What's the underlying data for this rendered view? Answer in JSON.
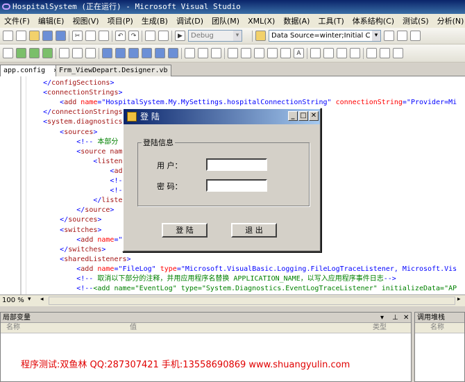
{
  "window": {
    "title": "HospitalSystem (正在运行) - Microsoft Visual Studio"
  },
  "menu": [
    "文件(F)",
    "编辑(E)",
    "视图(V)",
    "项目(P)",
    "生成(B)",
    "调试(D)",
    "团队(M)",
    "XML(X)",
    "数据(A)",
    "工具(T)",
    "体系结构(C)",
    "测试(S)",
    "分析(N)",
    "窗"
  ],
  "toolbar": {
    "config": "Debug",
    "datasource": "Data Source=winter;Initial C"
  },
  "tabs": [
    "app.config",
    "Frm_ViewDepart.Designer.vb"
  ],
  "editor": {
    "lines": [
      {
        "indent": "    ",
        "parts": [
          [
            "br",
            "</"
          ],
          [
            "tag",
            "configSections"
          ],
          [
            "br",
            ">"
          ]
        ]
      },
      {
        "indent": "    ",
        "parts": [
          [
            "br",
            "<"
          ],
          [
            "tag",
            "connectionStrings"
          ],
          [
            "br",
            ">"
          ]
        ]
      },
      {
        "indent": "        ",
        "parts": [
          [
            "br",
            "<"
          ],
          [
            "tag",
            "add "
          ],
          [
            "at",
            "name"
          ],
          [
            "br",
            "=\""
          ],
          [
            "av",
            "HospitalSystem.My.MySettings.hospitalConnectionString"
          ],
          [
            "br",
            "\" "
          ],
          [
            "at",
            "connectionString"
          ],
          [
            "br",
            "=\""
          ],
          [
            "av",
            "Provider=Mi"
          ]
        ]
      },
      {
        "indent": "    ",
        "parts": [
          [
            "br",
            "</"
          ],
          [
            "tag",
            "connectionStrings"
          ],
          [
            "br",
            ">"
          ]
        ]
      },
      {
        "indent": "    ",
        "parts": [
          [
            "br",
            "<"
          ],
          [
            "tag",
            "system.diagnostics"
          ],
          [
            "br",
            ">"
          ]
        ]
      },
      {
        "indent": "        ",
        "parts": [
          [
            "br",
            "<"
          ],
          [
            "tag",
            "sources"
          ],
          [
            "br",
            ">"
          ]
        ]
      },
      {
        "indent": "            ",
        "parts": [
          [
            "br",
            "<!--"
          ],
          [
            "cm",
            " 本部分"
          ]
        ]
      },
      {
        "indent": "            ",
        "parts": [
          [
            "br",
            "<"
          ],
          [
            "tag",
            "source nam"
          ]
        ]
      },
      {
        "indent": "                ",
        "parts": [
          [
            "br",
            "<"
          ],
          [
            "tag",
            "listen"
          ]
        ]
      },
      {
        "indent": "                    ",
        "parts": [
          [
            "br",
            "<"
          ],
          [
            "tag",
            "ad"
          ]
        ]
      },
      {
        "indent": "                    ",
        "parts": [
          [
            "br",
            "<!-"
          ]
        ]
      },
      {
        "indent": "                    ",
        "parts": [
          [
            "br",
            "<!-"
          ]
        ]
      },
      {
        "indent": "                ",
        "parts": [
          [
            "br",
            "</"
          ],
          [
            "tag",
            "liste"
          ]
        ]
      },
      {
        "indent": "            ",
        "parts": [
          [
            "br",
            "</"
          ],
          [
            "tag",
            "source"
          ],
          [
            "br",
            ">"
          ]
        ]
      },
      {
        "indent": "        ",
        "parts": [
          [
            "br",
            "</"
          ],
          [
            "tag",
            "sources"
          ],
          [
            "br",
            ">"
          ]
        ]
      },
      {
        "indent": "        ",
        "parts": [
          [
            "br",
            "<"
          ],
          [
            "tag",
            "switches"
          ],
          [
            "br",
            ">"
          ]
        ]
      },
      {
        "indent": "            ",
        "parts": [
          [
            "br",
            "<"
          ],
          [
            "tag",
            "add "
          ],
          [
            "at",
            "name"
          ],
          [
            "br",
            "=\""
          ]
        ]
      },
      {
        "indent": "        ",
        "parts": [
          [
            "br",
            "</"
          ],
          [
            "tag",
            "switches"
          ],
          [
            "br",
            ">"
          ]
        ]
      },
      {
        "indent": "        ",
        "parts": [
          [
            "br",
            "<"
          ],
          [
            "tag",
            "sharedListeners"
          ],
          [
            "br",
            ">"
          ]
        ]
      },
      {
        "indent": "            ",
        "parts": [
          [
            "br",
            "<"
          ],
          [
            "tag",
            "add "
          ],
          [
            "at",
            "name"
          ],
          [
            "br",
            "=\""
          ],
          [
            "av",
            "FileLog"
          ],
          [
            "br",
            "\" "
          ],
          [
            "at",
            "type"
          ],
          [
            "br",
            "=\""
          ],
          [
            "av",
            "Microsoft.VisualBasic.Logging.FileLogTraceListener, Microsoft.Vis"
          ]
        ]
      },
      {
        "indent": "            ",
        "parts": [
          [
            "br",
            "<!--"
          ],
          [
            "cm",
            " 取消以下部分的注释，并用应用程序名替换 APPLICATION_NAME，以写入应用程序事件日志"
          ],
          [
            "br",
            "-->"
          ]
        ]
      },
      {
        "indent": "            ",
        "parts": [
          [
            "br",
            "<!--"
          ],
          [
            "cm",
            "<add name=\"EventLog\" type=\"System.Diagnostics.EventLogTraceListener\" initializeData=\"AP"
          ]
        ]
      }
    ]
  },
  "zoom": "100 %",
  "dialog": {
    "title": "登 陆",
    "group": "登陆信息",
    "user_label": "用 户：",
    "pass_label": "密 码：",
    "user_value": "",
    "pass_value": "",
    "login": "登 陆",
    "exit": "退 出"
  },
  "locals": {
    "title": "局部变量",
    "cols": [
      "名称",
      "值",
      "类型"
    ]
  },
  "callstack": {
    "title": "调用堆栈",
    "cols": [
      "名称"
    ]
  },
  "watermark": "程序测试:双鱼林 QQ:287307421 手机:13558690869 www.shuangyulin.com"
}
